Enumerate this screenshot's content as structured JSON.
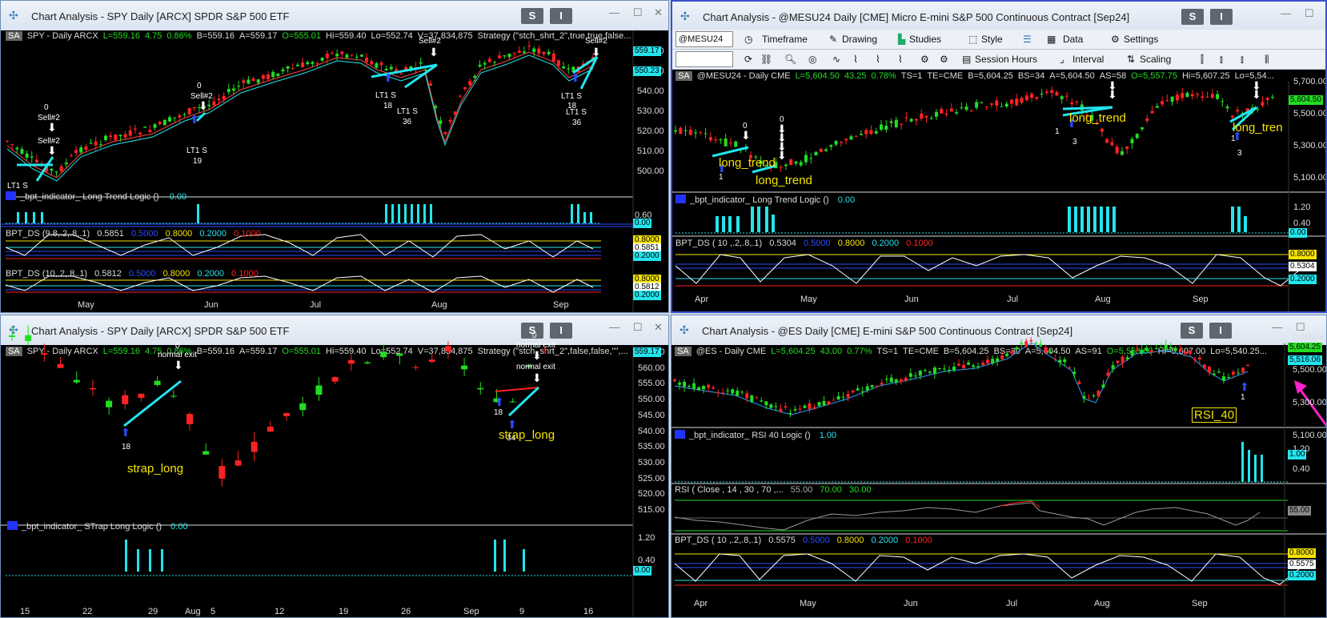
{
  "w1": {
    "title": "Chart Analysis - SPY Daily [ARCX] SPDR S&P 500 ETF",
    "s_btn": "S",
    "i_btn": "I",
    "info": {
      "sa": "SA",
      "sym": "SPY - Daily  ARCX",
      "last": "L=559.16",
      "chg": "4.75",
      "pct": "0.86%",
      "bid": "B=559.16",
      "ask": "A=559.17",
      "open": "O=555.01",
      "hi": "Hi=559.40",
      "lo": "Lo=552.74",
      "vol": "V=37,834,875",
      "strat": "Strategy (\"stch_shrt_2\",true,true,false..."
    },
    "prices": [
      "560.00",
      "550.00",
      "540.00",
      "530.00",
      "520.00",
      "510.00",
      "500.00"
    ],
    "last_tag": "559.17",
    "tag2": "550.23",
    "ind1": {
      "name": "_bpt_indicator_ Long Trend Logic ()",
      "val": "0.00",
      "axis1": "0.60",
      "axis2": "0.00"
    },
    "ind2": {
      "name": "BPT_DS (9.8,.2,.8,.1)",
      "val": "0.5851",
      "b": "0.5000",
      "y": "0.8000",
      "c": "0.2000",
      "r": "0.1000",
      "tag": "0.5851",
      "t1": "0.8000",
      "t2": "0.2000"
    },
    "ind3": {
      "name": "BPT_DS (10,.2,.8,.1)",
      "val": "0.5812",
      "b": "0.5000",
      "y": "0.8000",
      "c": "0.2000",
      "r": "0.1000",
      "tag": "0.5812",
      "t1": "0.8000",
      "t2": "0.2000"
    },
    "months": [
      "May",
      "Jun",
      "Jul",
      "Aug",
      "Sep"
    ],
    "notes": {
      "a_top": "0",
      "a_mid": "Sell#2",
      "b_top": "0",
      "b_mid": "Sell#2",
      "b_bot": "LT1 S",
      "b_num": "19",
      "c_top": "Sell#2",
      "c_lt1": "LT1 S",
      "c_n1": "18",
      "c_lt2": "LT1 S",
      "c_n2": "36",
      "d_top": "Sell#2",
      "d_lt1": "LT1 S",
      "d_n1": "18",
      "d_lt2": "LT1 S",
      "d_n2": "36",
      "e_bot": "LT1 S"
    }
  },
  "w2": {
    "title": "Chart Analysis - @MESU24 Daily [CME] Micro E-mini S&P 500 Continuous Contract [Sep24]",
    "s_btn": "S",
    "i_btn": "I",
    "toolbar": {
      "symbol": "@MESU24",
      "timeframe": "Timeframe",
      "drawing": "Drawing",
      "studies": "Studies",
      "style": "Style",
      "data": "Data",
      "settings": "Settings",
      "session": "Session Hours",
      "interval": "Interval",
      "scaling": "Scaling"
    },
    "info": {
      "sa": "SA",
      "sym": "@MESU24 - Daily  CME",
      "last": "L=5,604.50",
      "chg": "43.25",
      "pct": "0.78%",
      "ts": "TS=1",
      "te": "TE=CME",
      "bid": "B=5,604.25",
      "bs": "BS=34",
      "ask": "A=5,604.50",
      "as": "AS=58",
      "open": "O=5,557.75",
      "hi": "Hi=5,607.25",
      "lo": "Lo=5,54..."
    },
    "prices": [
      "5,700.00",
      "5,500.00",
      "5,300.00",
      "5,100.00"
    ],
    "last_tag": "5,604.50",
    "ind1": {
      "name": "_bpt_indicator_ Long Trend Logic ()",
      "val": "0.00",
      "axis1": "1.20",
      "axis2": "0.40",
      "tag": "0.00"
    },
    "ind2": {
      "name": "BPT_DS ( 10 ,.2,.8,.1)",
      "val": "0.5304",
      "b": "0.5000",
      "y": "0.8000",
      "c": "0.2000",
      "r": "0.1000",
      "tag": "0.5304",
      "t1": "0.8000",
      "t2": "0.2000"
    },
    "months": [
      "Apr",
      "May",
      "Jun",
      "Jul",
      "Aug",
      "Sep"
    ],
    "yellow": [
      "long_trend",
      "long_trend",
      "long_trend",
      "long_tren"
    ],
    "notes": {
      "n0a": "0",
      "n0b": "0",
      "n1a": "1",
      "n1b": "1",
      "n1c": "1",
      "n3a": "3",
      "n3b": "3"
    }
  },
  "w3": {
    "title": "Chart Analysis - SPY Daily [ARCX] SPDR S&P 500 ETF",
    "s_btn": "S",
    "i_btn": "I",
    "info": {
      "sa": "SA",
      "sym": "SPY - Daily  ARCX",
      "last": "L=559.16",
      "chg": "4.75",
      "pct": "0.86%",
      "bid": "B=559.16",
      "ask": "A=559.17",
      "open": "O=555.01",
      "hi": "Hi=559.40",
      "lo": "Lo=552.74",
      "vol": "V=37,834,875",
      "strat": "Strategy (\"stch_shrt_2\",false,false,\"\",..."
    },
    "prices": [
      "565.00",
      "560.00",
      "555.00",
      "550.00",
      "545.00",
      "540.00",
      "535.00",
      "530.00",
      "525.00",
      "520.00",
      "515.00"
    ],
    "last_tag": "559.17",
    "ind1": {
      "name": "_bpt_indicator_ STrap Long Logic ()",
      "val": "0.00",
      "axis1": "1.20",
      "axis2": "0.40",
      "tag": "0.00"
    },
    "days": [
      "15",
      "22",
      "29",
      "Aug",
      "5",
      "12",
      "19",
      "26",
      "Sep",
      "9",
      "16"
    ],
    "notes": {
      "a_top": "0",
      "a_exit": "normal exit",
      "a_num": "18",
      "b_top": "0",
      "b_exit1": "normal exit",
      "b_exit2": "normal exit",
      "b_n1": "18",
      "b_n2": "34"
    },
    "yellow": [
      "strap_long",
      "strap_long"
    ]
  },
  "w4": {
    "title": "Chart Analysis - @ES Daily [CME] E-mini S&P 500 Continuous Contract [Sep24]",
    "s_btn": "S",
    "i_btn": "I",
    "info": {
      "sa": "SA",
      "sym": "@ES - Daily  CME",
      "last": "L=5,604.25",
      "chg": "43.00",
      "pct": "0.77%",
      "ts": "TS=1",
      "te": "TE=CME",
      "bid": "B=5,604.25",
      "bs": "BS=30",
      "ask": "A=5,604.50",
      "as": "AS=91",
      "open": "O=5,558.00",
      "hi": "Hi=5,607.00",
      "lo": "Lo=5,540.25..."
    },
    "prices": [
      "5,700.00",
      "5,500.00",
      "5,300.00",
      "5,100.00"
    ],
    "last_tag": "5,604.25",
    "tag2": "5,516.06",
    "ind1": {
      "name": "_bpt_indicator_ RSI 40 Logic ()",
      "val": "1.00",
      "axis1": "1.20",
      "axis2": "0.40",
      "tag": "1.00"
    },
    "ind2": {
      "name": "RSI ( Close , 14 , 30 , 70 ,...",
      "v1": "55.00",
      "v2": "70.00",
      "v3": "30.00",
      "tag": "55.00"
    },
    "ind3": {
      "name": "BPT_DS ( 10 ,.2,.8,.1)",
      "val": "0.5575",
      "b": "0.5000",
      "y": "0.8000",
      "c": "0.2000",
      "r": "0.1000",
      "tag": "0.5575",
      "t1": "0.8000",
      "t2": "0.2000"
    },
    "months": [
      "Apr",
      "May",
      "Jun",
      "Jul",
      "Aug",
      "Sep"
    ],
    "rsi_label": "RSI_40",
    "note1": "1"
  },
  "colors": {
    "green": "#22dd22",
    "red": "#ff2222",
    "cyan": "#22e5ee",
    "yellow": "#f5e300",
    "blue": "#2a4cff",
    "magenta": "#ff22cc"
  }
}
